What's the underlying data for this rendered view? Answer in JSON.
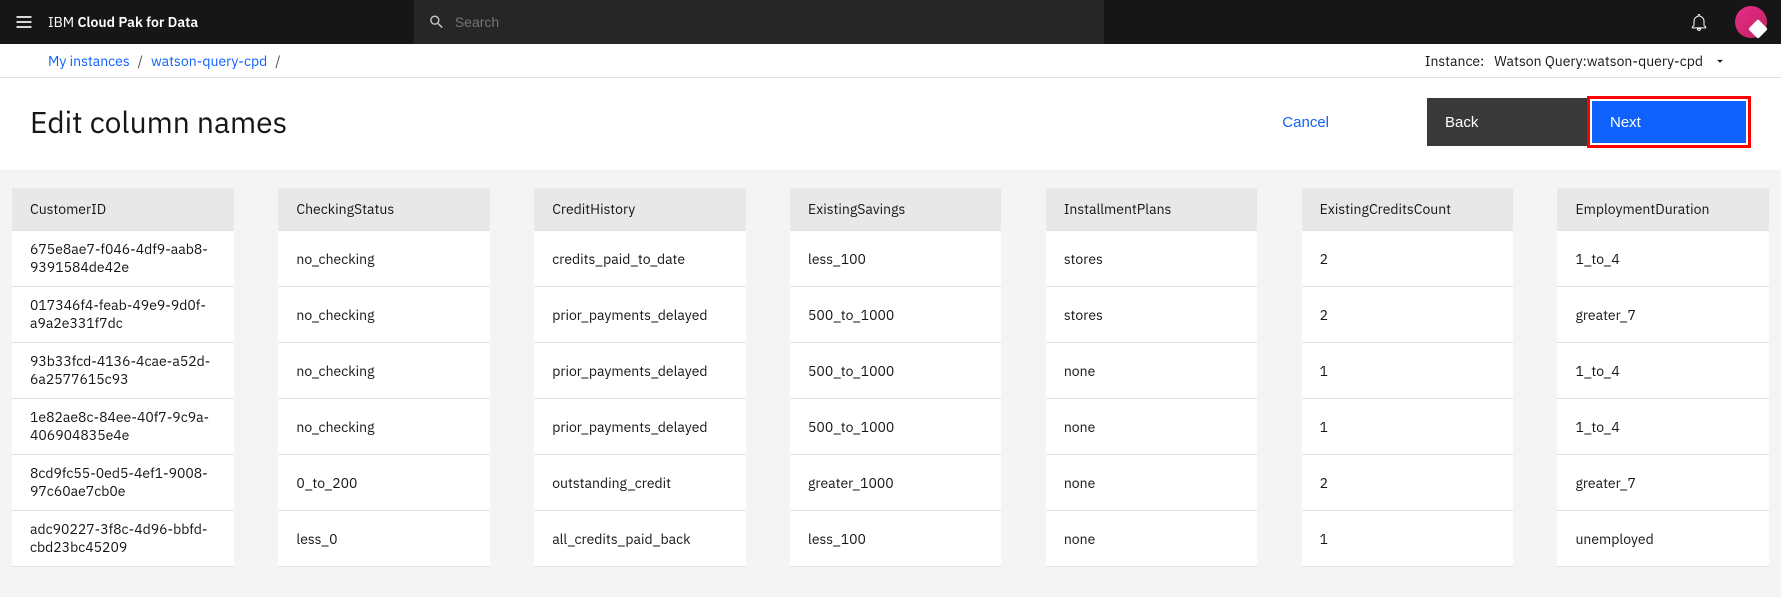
{
  "header": {
    "product_prefix": "IBM",
    "product_name": "Cloud Pak for Data",
    "search_placeholder": "Search"
  },
  "breadcrumb": {
    "item1": "My instances",
    "item2": "watson-query-cpd"
  },
  "instance": {
    "label": "Instance:",
    "value": "Watson Query:watson-query-cpd"
  },
  "page": {
    "title": "Edit column names",
    "cancel": "Cancel",
    "back": "Back",
    "next": "Next"
  },
  "table": {
    "columns": {
      "c0": "CustomerID",
      "c1": "CheckingStatus",
      "c2": "CreditHistory",
      "c3": "ExistingSavings",
      "c4": "InstallmentPlans",
      "c5": "ExistingCreditsCount",
      "c6": "EmploymentDuration"
    },
    "rows": [
      {
        "c0": "675e8ae7-f046-4df9-aab8-9391584de42e",
        "c1": "no_checking",
        "c2": "credits_paid_to_date",
        "c3": "less_100",
        "c4": "stores",
        "c5": "2",
        "c6": "1_to_4"
      },
      {
        "c0": "017346f4-feab-49e9-9d0f-a9a2e331f7dc",
        "c1": "no_checking",
        "c2": "prior_payments_delayed",
        "c3": "500_to_1000",
        "c4": "stores",
        "c5": "2",
        "c6": "greater_7"
      },
      {
        "c0": "93b33fcd-4136-4cae-a52d-6a2577615c93",
        "c1": "no_checking",
        "c2": "prior_payments_delayed",
        "c3": "500_to_1000",
        "c4": "none",
        "c5": "1",
        "c6": "1_to_4"
      },
      {
        "c0": "1e82ae8c-84ee-40f7-9c9a-406904835e4e",
        "c1": "no_checking",
        "c2": "prior_payments_delayed",
        "c3": "500_to_1000",
        "c4": "none",
        "c5": "1",
        "c6": "1_to_4"
      },
      {
        "c0": "8cd9fc55-0ed5-4ef1-9008-97c60ae7cb0e",
        "c1": "0_to_200",
        "c2": "outstanding_credit",
        "c3": "greater_1000",
        "c4": "none",
        "c5": "2",
        "c6": "greater_7"
      },
      {
        "c0": "adc90227-3f8c-4d96-bbfd-cbd23bc45209",
        "c1": "less_0",
        "c2": "all_credits_paid_back",
        "c3": "less_100",
        "c4": "none",
        "c5": "1",
        "c6": "unemployed"
      }
    ]
  }
}
